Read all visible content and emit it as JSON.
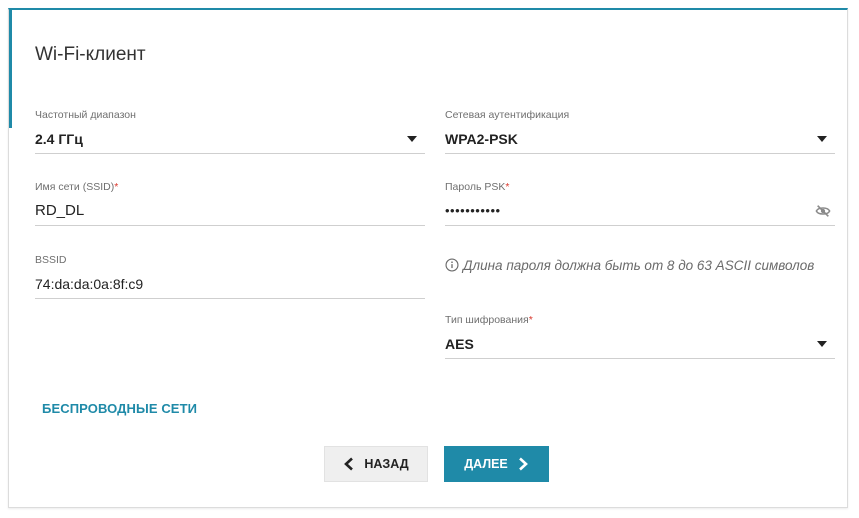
{
  "page": {
    "title": "Wi-Fi-клиент",
    "accent_color": "#1f8aa8"
  },
  "left": {
    "band": {
      "label": "Частотный диапазон",
      "value": "2.4 ГГц"
    },
    "ssid": {
      "label": "Имя сети (SSID)",
      "required_mark": "*",
      "value": "RD_DL"
    },
    "bssid": {
      "label": "BSSID",
      "value": "74:da:da:0a:8f:c9"
    }
  },
  "right": {
    "auth": {
      "label": "Сетевая аутентификация",
      "value": "WPA2-PSK"
    },
    "psk": {
      "label": "Пароль PSK",
      "required_mark": "*",
      "value": "•••••••••••",
      "toggle_icon": "eye-off-icon"
    },
    "hint": "Длина пароля должна быть от 8 до 63 ASCII символов",
    "cipher": {
      "label": "Тип шифрования",
      "required_mark": "*",
      "value": "AES"
    }
  },
  "links": {
    "wireless_networks": "БЕСПРОВОДНЫЕ СЕТИ"
  },
  "buttons": {
    "back": "НАЗАД",
    "next": "ДАЛЕЕ"
  }
}
